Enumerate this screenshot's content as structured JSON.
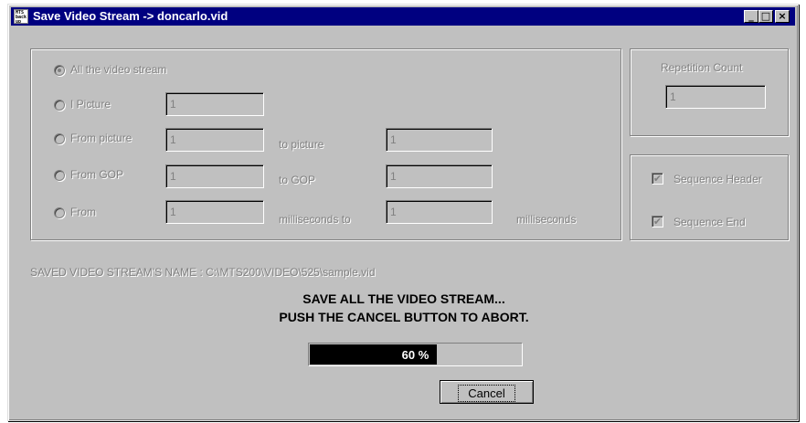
{
  "window": {
    "title": "Save Video Stream -> doncarlo.vid",
    "icon_text": "MTS back up",
    "controls": {
      "minimize": "_",
      "maximize": "□",
      "close": "×"
    }
  },
  "range": {
    "options": [
      {
        "label": "All the video stream",
        "selected": true
      },
      {
        "label": "I Picture",
        "selected": false,
        "value": "1"
      },
      {
        "label": "From picture",
        "selected": false,
        "from_value": "1",
        "to_label": "to picture",
        "to_value": "1"
      },
      {
        "label": "From GOP",
        "selected": false,
        "from_value": "1",
        "to_label": "to GOP",
        "to_value": "1"
      },
      {
        "label": "From",
        "selected": false,
        "from_value": "1",
        "to_label": "milliseconds to",
        "to_value": "1",
        "unit_label": "milliseconds"
      }
    ]
  },
  "repetition": {
    "label": "Repetition Count",
    "value": "1"
  },
  "options": {
    "sequence_header": {
      "label": "Sequence Header",
      "checked": true
    },
    "sequence_end": {
      "label": "Sequence End",
      "checked": true
    }
  },
  "saved_name": "SAVED VIDEO STREAM'S NAME : C:\\MTS200\\VIDEO\\525\\sample.vid",
  "message": {
    "line1": "SAVE ALL THE VIDEO STREAM...",
    "line2": "PUSH THE CANCEL BUTTON TO ABORT."
  },
  "progress": {
    "value": 0.6,
    "label": "60 %"
  },
  "cancel_label": "Cancel",
  "colors": {
    "face": "#c0c0c0",
    "titlebar": "#000080",
    "disabled_text": "#808080"
  }
}
